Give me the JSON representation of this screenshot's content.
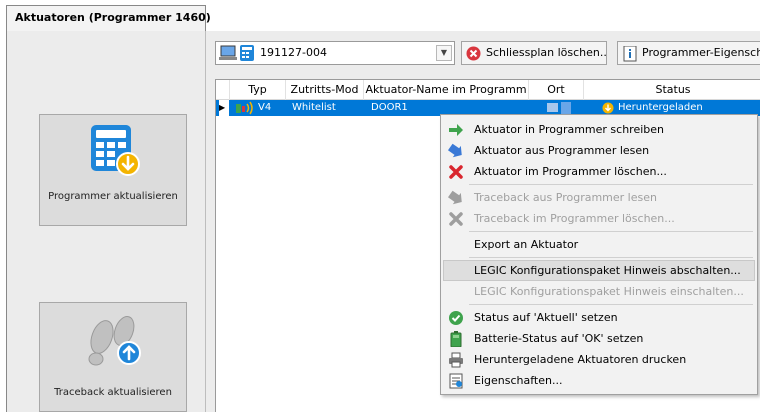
{
  "tab": {
    "title": "Aktuatoren (Programmer 1460)"
  },
  "left": {
    "programmer_button_label": "Programmer aktualisieren",
    "traceback_button_label": "Traceback aktualisieren"
  },
  "toolbar": {
    "combo_value": "191127-004",
    "clear_plan_label": "Schliessplan löschen...",
    "programmer_props_label": "Programmer-Eigenschaften"
  },
  "grid": {
    "columns": [
      "Typ",
      "Zutritts-Mod",
      "Aktuator-Name im Programm",
      "Ort",
      "Status"
    ],
    "row": {
      "typ": "V4",
      "mode": "Whitelist",
      "name": "DOOR1",
      "status": "Heruntergeladen"
    }
  },
  "menu": {
    "items": [
      {
        "label": "Aktuator in Programmer schreiben",
        "icon": "write-green-arrow-icon",
        "enabled": true
      },
      {
        "label": "Aktuator aus Programmer lesen",
        "icon": "read-blue-arrow-icon",
        "enabled": true
      },
      {
        "label": "Aktuator im Programmer löschen...",
        "icon": "red-x-icon",
        "enabled": true
      },
      {
        "label": "Traceback aus Programmer lesen",
        "icon": "gray-arrow-icon",
        "enabled": false
      },
      {
        "label": "Traceback im Programmer löschen...",
        "icon": "gray-x-icon",
        "enabled": false
      },
      {
        "label": "Export an Aktuator",
        "icon": "",
        "enabled": true
      },
      {
        "label": "LEGIC Konfigurationspaket Hinweis abschalten...",
        "icon": "",
        "enabled": true
      },
      {
        "label": "LEGIC Konfigurationspaket Hinweis einschalten...",
        "icon": "",
        "enabled": false
      },
      {
        "label": "Status auf 'Aktuell' setzen",
        "icon": "green-check-icon",
        "enabled": true
      },
      {
        "label": "Batterie-Status auf 'OK' setzen",
        "icon": "battery-icon",
        "enabled": true
      },
      {
        "label": "Heruntergeladene Aktuatoren drucken",
        "icon": "printer-icon",
        "enabled": true
      },
      {
        "label": "Eigenschaften...",
        "icon": "properties-icon",
        "enabled": true
      }
    ]
  },
  "colors": {
    "selection": "#0078d7",
    "panel": "#ececec",
    "menu_bg": "#f2f2f2",
    "calculator": "#1f86d9"
  }
}
